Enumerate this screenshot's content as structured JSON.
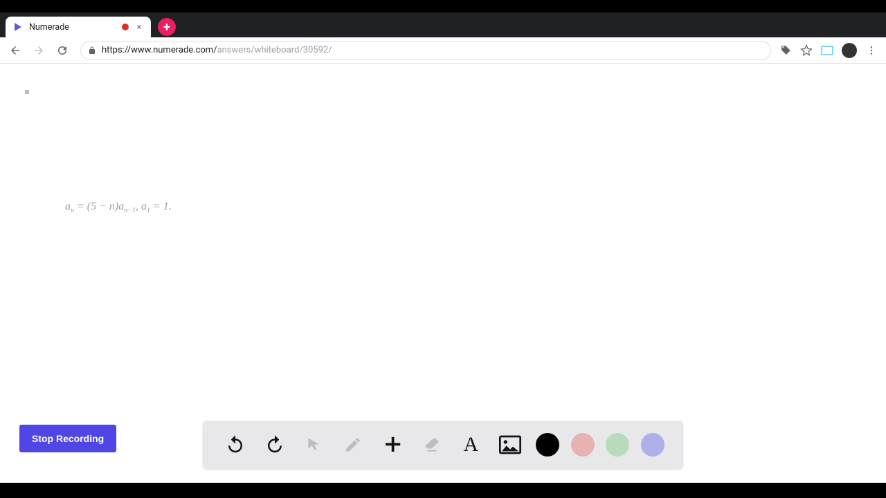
{
  "browser": {
    "tab": {
      "title": "Numerade",
      "recording": true
    },
    "url_secure_part": "https://www.numerade.com/",
    "url_path_part": "answers/whiteboard/30592/",
    "new_tab_glyph": "+",
    "close_glyph": "×"
  },
  "whiteboard": {
    "formula_html": "a<sub>n</sub> = (5 − n)a<sub>n−1</sub>, a<sub>1</sub> = 1.",
    "stop_label": "Stop Recording",
    "tools": {
      "undo": "undo-icon",
      "redo": "redo-icon",
      "pointer": "pointer-icon",
      "pen": "pen-icon",
      "plus": "plus-icon",
      "eraser": "eraser-icon",
      "text": "A",
      "image": "image-icon"
    },
    "colors": {
      "black": "#000000",
      "red": "#e79791",
      "green": "#8fd28f",
      "blue": "#9b9be8"
    }
  },
  "icons": {
    "back": "←",
    "forward": "→",
    "reload": "⟳",
    "bookmark": "☆",
    "menu": "⋮",
    "tag": "🏷"
  }
}
